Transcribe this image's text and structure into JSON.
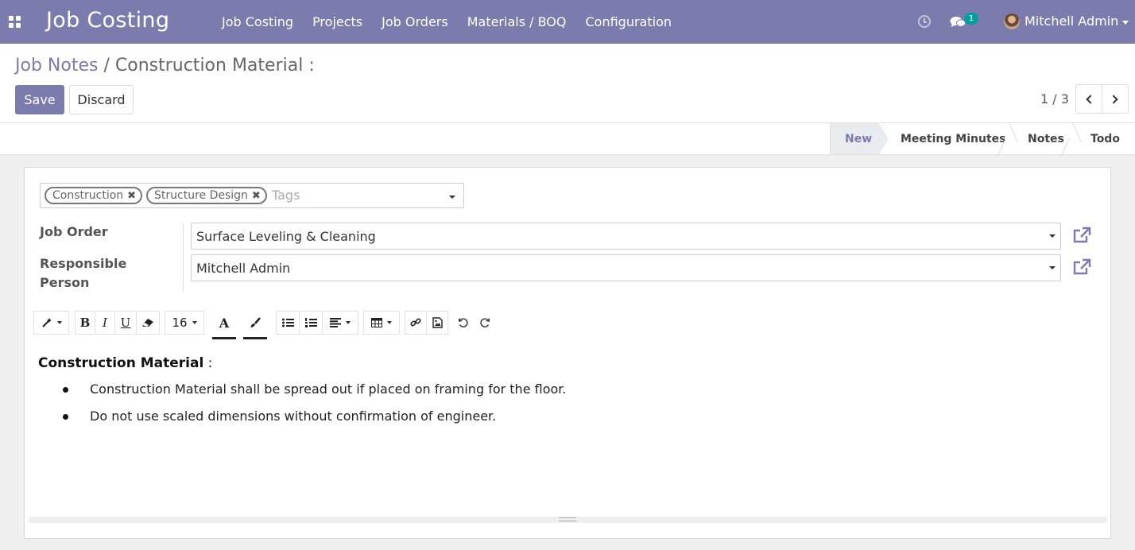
{
  "navbar": {
    "app_title": "Job Costing",
    "menu": [
      {
        "label": "Job Costing"
      },
      {
        "label": "Projects"
      },
      {
        "label": "Job Orders"
      },
      {
        "label": "Materials / BOQ"
      },
      {
        "label": "Configuration"
      }
    ],
    "chat_badge": "1",
    "user_name": "Mitchell Admin",
    "icons": [
      "apps-grid-icon",
      "clock-icon",
      "chat-icon",
      "avatar"
    ],
    "bg_color": "#7c7bad"
  },
  "breadcrumb": {
    "parent": "Job Notes",
    "separator": "/",
    "current": "Construction Material :"
  },
  "buttons": {
    "save": "Save",
    "discard": "Discard"
  },
  "pager": {
    "value": "1 / 3"
  },
  "stages": {
    "active": "New",
    "items": [
      "New",
      "Meeting Minutes",
      "Notes",
      "Todo"
    ]
  },
  "form": {
    "tags": [
      "Construction",
      "Structure Design"
    ],
    "tags_placeholder": "Tags",
    "job_order_label": "Job Order",
    "job_order_value": "Surface Leveling & Cleaning",
    "responsible_label": "Responsible Person",
    "responsible_value": "Mitchell Admin"
  },
  "toolbar": {
    "font_size": "16",
    "bold": "B",
    "italic": "I",
    "underline": "U",
    "font_color": "A"
  },
  "content": {
    "heading": "Construction Material",
    "heading_suffix": " :",
    "bullets": [
      "Construction Material shall be spread out if placed on framing for the floor.",
      "Do not use scaled dimensions without confirmation of engineer."
    ]
  }
}
